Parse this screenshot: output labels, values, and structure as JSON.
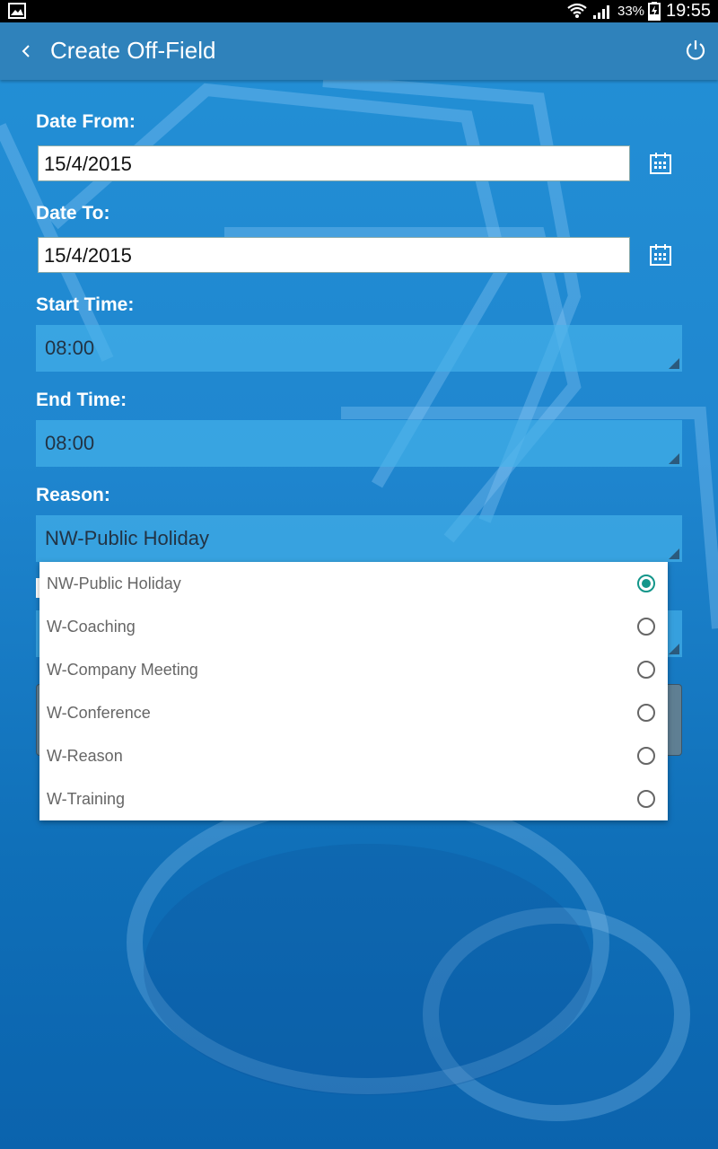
{
  "status_bar": {
    "battery_percent": "33%",
    "time": "19:55"
  },
  "app_bar": {
    "title": "Create Off-Field"
  },
  "form": {
    "date_from": {
      "label": "Date From:",
      "value": "15/4/2015"
    },
    "date_to": {
      "label": "Date To:",
      "value": "15/4/2015"
    },
    "start_time": {
      "label": "Start Time:",
      "value": "08:00"
    },
    "end_time": {
      "label": "End Time:",
      "value": "08:00"
    },
    "reason": {
      "label": "Reason:",
      "value": "NW-Public Holiday"
    }
  },
  "reason_dropdown": {
    "options": [
      {
        "label": "NW-Public Holiday",
        "selected": true
      },
      {
        "label": "W-Coaching",
        "selected": false
      },
      {
        "label": "W-Company Meeting",
        "selected": false
      },
      {
        "label": "W-Conference",
        "selected": false
      },
      {
        "label": "W-Reason",
        "selected": false
      },
      {
        "label": "W-Training",
        "selected": false
      }
    ]
  },
  "icons": {
    "back": "chevron-left-icon",
    "power": "power-icon",
    "calendar": "calendar-icon",
    "gallery": "gallery-icon",
    "wifi": "wifi-icon",
    "signal": "signal-icon",
    "battery": "battery-charging-icon"
  },
  "colors": {
    "app_bar": "#2f82bb",
    "background": "#1f86cf",
    "radio_selected": "#13968a"
  }
}
